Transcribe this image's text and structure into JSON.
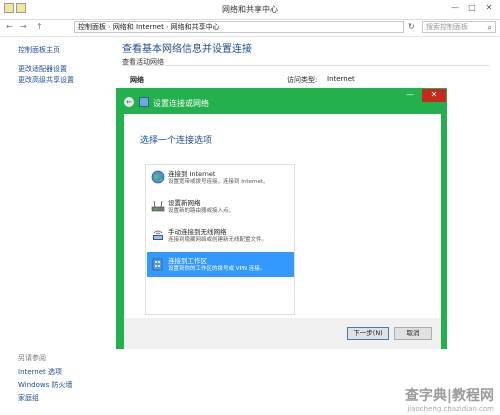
{
  "window": {
    "title": "网络和共享中心",
    "controls": {
      "minimize": "—",
      "maximize": "□",
      "close": "✕"
    }
  },
  "address_bar": {
    "nav_back": "←",
    "nav_forward": "→",
    "nav_up": "↑",
    "crumbs": [
      "控制面板",
      "网络和 Internet",
      "网络和共享中心"
    ],
    "search_placeholder": "搜索控制面板"
  },
  "left_pane": {
    "home_link": "控制面板主页",
    "links": [
      "更改适配器设置",
      "更改高级共享设置"
    ],
    "see_also_heading": "另请参阅",
    "see_also": [
      "Internet 选项",
      "Windows 防火墙",
      "家庭组"
    ]
  },
  "main": {
    "title": "查看基本网络信息并设置连接",
    "active_networks_heading": "查看活动网络",
    "network_label": "网络",
    "access_type_label": "访问类型:",
    "access_type_value": "Internet"
  },
  "dialog": {
    "title": "设置连接或网络",
    "back_icon": "←",
    "minimize": "—",
    "close": "✕",
    "heading": "选择一个连接选项",
    "options": [
      {
        "title": "连接到 Internet",
        "description": "设置宽带或拨号连接，连接到 Internet。",
        "icon": "globe-icon",
        "selected": false
      },
      {
        "title": "设置新网络",
        "description": "设置新的路由器或接入点。",
        "icon": "router-icon",
        "selected": false
      },
      {
        "title": "手动连接到无线网络",
        "description": "连接到隐藏网络或创建新无线配置文件。",
        "icon": "wireless-icon",
        "selected": false
      },
      {
        "title": "连接到工作区",
        "description": "设置到你的工作区的拨号或 VPN 连接。",
        "icon": "workplace-icon",
        "selected": true
      }
    ],
    "next_button": "下一步(N)",
    "cancel_button": "取消"
  },
  "watermark": {
    "main": "查字典|教程网",
    "url": "jiaocheng.chazidian.com"
  },
  "colors": {
    "dialog_frame": "#22b14c",
    "selection": "#3399ff",
    "link": "#1f4e9c",
    "heading": "#1d4f91",
    "close_red": "#c42b1c"
  }
}
